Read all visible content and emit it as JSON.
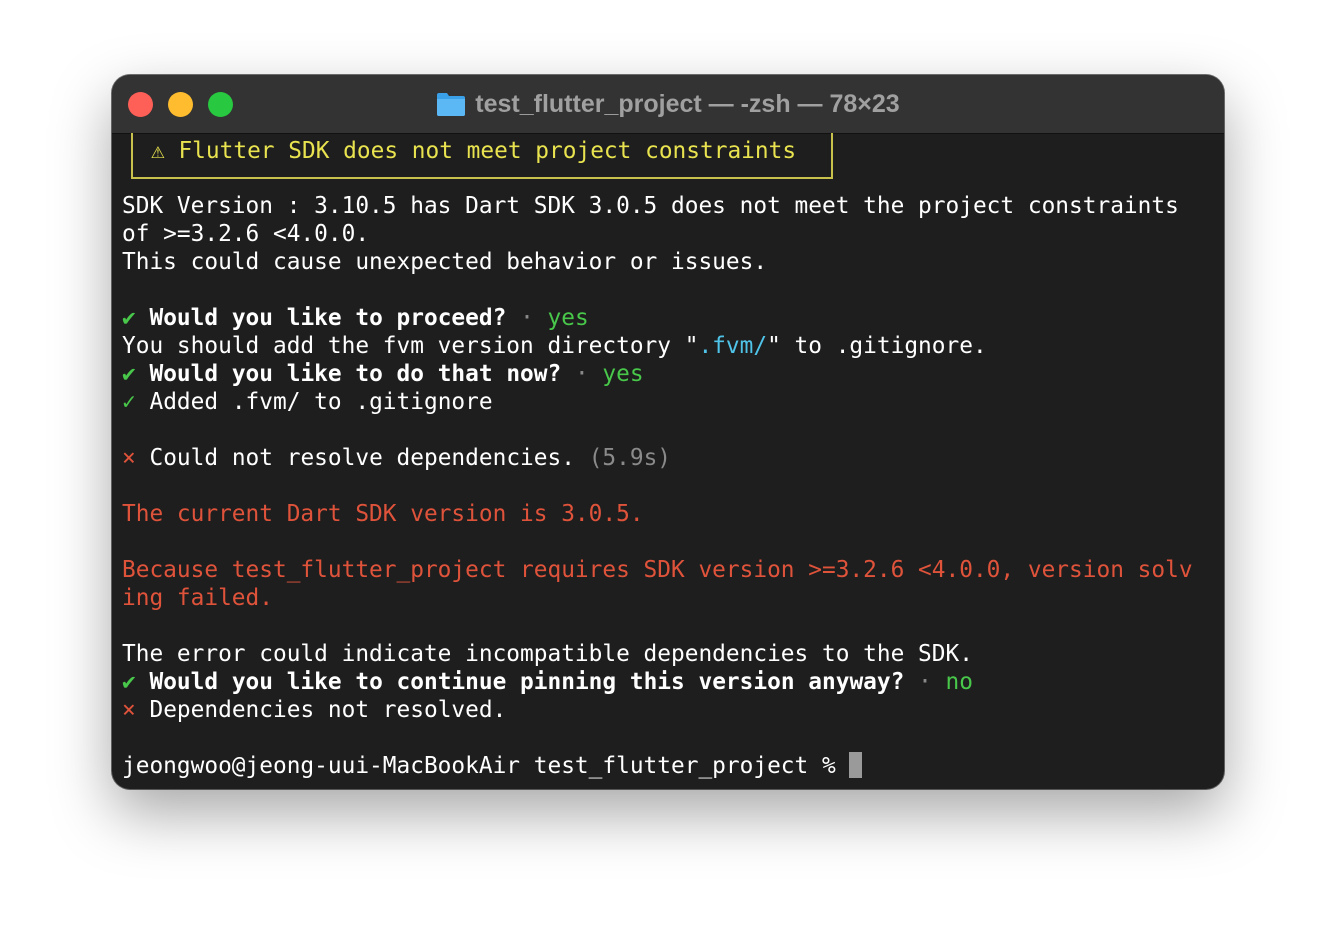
{
  "window": {
    "title": "test_flutter_project — -zsh — 78×23"
  },
  "terminal": {
    "warning": "⚠ Flutter SDK does not meet project constraints",
    "sdk_line1": "SDK Version : 3.10.5 has Dart SDK 3.0.5 does not meet the project constraints",
    "sdk_line2": "of >=3.2.6 <4.0.0.",
    "sdk_line3": "This could cause unexpected behavior or issues.",
    "q1_check": "✔",
    "q1_text": "Would you like to proceed?",
    "q1_sep": "·",
    "q1_answer": "yes",
    "add_prefix": "You should add the fvm version directory \"",
    "add_path": ".fvm/",
    "add_suffix": "\" to .gitignore.",
    "q2_check": "✔",
    "q2_text": "Would you like to do that now?",
    "q2_sep": "·",
    "q2_answer": "yes",
    "added_check": "✓",
    "added_text": "Added .fvm/ to .gitignore",
    "resolve_mark": "×",
    "resolve_text": "Could not resolve dependencies.",
    "resolve_time": "(5.9s)",
    "err_current": "The current Dart SDK version is 3.0.5.",
    "err_because1": "Because test_flutter_project requires SDK version >=3.2.6 <4.0.0, version solv",
    "err_because2": "ing failed.",
    "err_indicate": "The error could indicate incompatible dependencies to the SDK.",
    "q3_check": "✔",
    "q3_text": "Would you like to continue pinning this version anyway?",
    "q3_sep": "·",
    "q3_answer": "no",
    "notres_mark": "×",
    "notres_text": "Dependencies not resolved.",
    "prompt": "jeongwoo@jeong-uui-MacBookAir test_flutter_project % "
  },
  "colors": {
    "background": "#1e1e1e",
    "titlebar": "#333333",
    "warning": "#e8e34f",
    "success": "#48c74a",
    "error": "#e0533b",
    "path": "#4fc3e8"
  }
}
